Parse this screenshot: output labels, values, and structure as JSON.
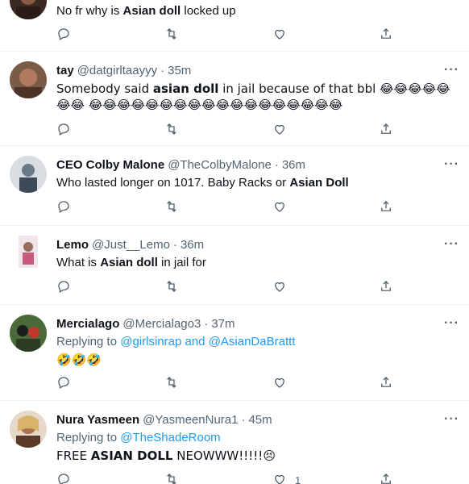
{
  "tweets": [
    {
      "name": "",
      "handle": "",
      "time": "",
      "text_parts": [
        {
          "t": "No fr why is ",
          "b": false
        },
        {
          "t": "Asian doll",
          "b": true
        },
        {
          "t": " locked up",
          "b": false
        }
      ],
      "like_count": ""
    },
    {
      "name": "tay",
      "handle": "@datgirltaayyy",
      "time": "35m",
      "text_parts": [
        {
          "t": "Somebody said ",
          "b": false
        },
        {
          "t": "asian doll",
          "b": true
        },
        {
          "t": " in jail because of that bbl 😂😂😂😂😂😂😂 😂😂😂😂😂😂😂😂😂😂😂😂😂😂😂😂😂😂",
          "b": false
        }
      ],
      "like_count": ""
    },
    {
      "name": "CEO Colby Malone",
      "handle": "@TheColbyMalone",
      "time": "36m",
      "text_parts": [
        {
          "t": "Who lasted longer on 1017. Baby Racks or ",
          "b": false
        },
        {
          "t": "Asian Doll",
          "b": true
        }
      ],
      "like_count": ""
    },
    {
      "name": "Lemo",
      "handle": "@Just__Lemo",
      "time": "36m",
      "text_parts": [
        {
          "t": "What is ",
          "b": false
        },
        {
          "t": "Asian doll",
          "b": true
        },
        {
          "t": " in jail for",
          "b": false
        }
      ],
      "like_count": ""
    },
    {
      "name": "Mercialago",
      "handle": "@Mercialago3",
      "time": "37m",
      "reply_prefix": "Replying to ",
      "reply_mentions": [
        "@girlsinrap",
        "@AsianDaBrattt"
      ],
      "reply_joiner": " and ",
      "text_parts": [
        {
          "t": "🤣🤣🤣",
          "b": false
        }
      ],
      "like_count": ""
    },
    {
      "name": "Nura Yasmeen",
      "handle": "@YasmeenNura1",
      "time": "45m",
      "reply_prefix": "Replying to ",
      "reply_mentions": [
        "@TheShadeRoom"
      ],
      "reply_joiner": "",
      "text_parts": [
        {
          "t": "FREE ",
          "b": false
        },
        {
          "t": "ASIAN DOLL",
          "b": true
        },
        {
          "t": " NEOWWW!!!!!😣",
          "b": false
        }
      ],
      "like_count": "1"
    }
  ],
  "ui": {
    "more_label": "···",
    "dot": "·"
  },
  "icons": [
    "reply-icon",
    "retweet-icon",
    "like-icon",
    "share-icon",
    "more-icon"
  ],
  "colors": {
    "text": "#0f1419",
    "secondary": "#536471",
    "link": "#1d9bf0",
    "divider": "#eff3f4"
  }
}
